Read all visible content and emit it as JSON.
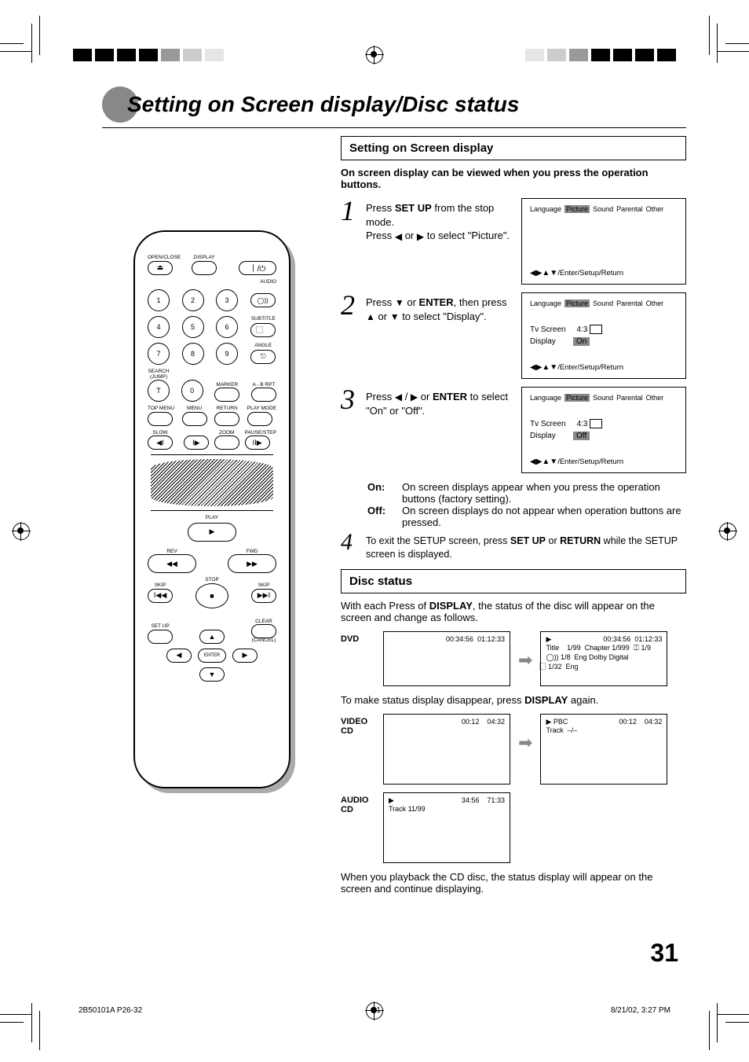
{
  "page_title": "Setting on Screen display/Disc status",
  "section1": {
    "heading": "Setting on Screen display",
    "intro": "On screen display can be viewed when you press the operation buttons.",
    "step1_a": "Press ",
    "step1_b": "SET UP",
    "step1_c": " from the stop mode.",
    "step1_d": "Press ",
    "step1_e": " or ",
    "step1_f": " to select \"Picture\".",
    "step2_a": "Press ",
    "step2_b": " or ",
    "step2_c": "ENTER",
    "step2_d": ", then press ",
    "step2_e": " or ",
    "step2_f": " to select \"Display\".",
    "step3_a": "Press ",
    "step3_b": " / ",
    "step3_c": " or ",
    "step3_d": "ENTER",
    "step3_e": " to select \"On\" or \"Off\".",
    "def_on_t": "On:",
    "def_on": "On screen displays appear when you press the operation buttons (factory setting).",
    "def_off_t": "Off:",
    "def_off": "On screen displays do not appear when operation buttons are pressed.",
    "step4_a": "To exit the SETUP screen, press ",
    "step4_b": "SET UP",
    "step4_c": " or ",
    "step4_d": "RETURN",
    "step4_e": " while the SETUP screen is displayed."
  },
  "osd": {
    "tabs": [
      "Language",
      "Picture",
      "Sound",
      "Parental",
      "Other"
    ],
    "tv_screen_label": "Tv Screen",
    "tv_screen_value": "4:3",
    "display_label": "Display",
    "display_on": "On",
    "display_off": "Off",
    "foot": "/Enter/Setup/Return"
  },
  "section2": {
    "heading": "Disc status",
    "intro_a": "With each Press of ",
    "intro_b": "DISPLAY",
    "intro_c": ", the status of the disc will appear on the screen and change as follows.",
    "after_dvd_a": "To make status display disappear, press ",
    "after_dvd_b": "DISPLAY",
    "after_dvd_c": " again.",
    "cd_note": "When you playback the CD disc, the status display will appear on the screen and continue displaying."
  },
  "status": {
    "dvd_label": "DVD",
    "vcd_label": "VIDEO CD",
    "acd_label": "AUDIO CD",
    "dvd_box1_t1": "00:34:56",
    "dvd_box1_t2": "01:12:33",
    "dvd_box2_t1": "00:34:56",
    "dvd_box2_t2": "01:12:33",
    "dvd_title": "Title",
    "dvd_title_v": "1/99",
    "dvd_chapter": "Chapter",
    "dvd_chapter_v": "1/999",
    "dvd_angle_v": "1/9",
    "dvd_audio_v": "1/8",
    "dvd_audio_t": "Eng Dolby Digital",
    "dvd_sub_v": "1/32",
    "dvd_sub_t": "Eng",
    "vcd_t1": "00:12",
    "vcd_t2": "04:32",
    "vcd_pbc": "PBC",
    "vcd_track": "Track",
    "vcd_track_v": "–/–",
    "acd_t1": "34:56",
    "acd_t2": "71:33",
    "acd_track": "Track 11/99"
  },
  "remote": {
    "open_close": "OPEN/CLOSE",
    "display": "DISPLAY",
    "audio": "AUDIO",
    "subtitle": "SUBTITLE",
    "angle": "ANGLE",
    "search": "SEARCH",
    "jump": "(JUMP)",
    "marker": "MARKER",
    "abrpt": "A - B RPT",
    "t": "T",
    "top_menu": "TOP MENU",
    "menu": "MENU",
    "return": "RETURN",
    "play_mode": "PLAY MODE",
    "slow": "SLOW",
    "zoom": "ZOOM",
    "pause": "PAUSE/STEP",
    "play": "PLAY",
    "rev": "REV",
    "fwd": "FWD",
    "skip": "SKIP",
    "stop": "STOP",
    "setup": "SET UP",
    "clear": "CLEAR",
    "cancel": "(CANCEL)",
    "enter": "ENTER"
  },
  "page_number": "31",
  "footer": {
    "left": "2B50101A P26-32",
    "mid": "31",
    "right": "8/21/02, 3:27 PM"
  }
}
